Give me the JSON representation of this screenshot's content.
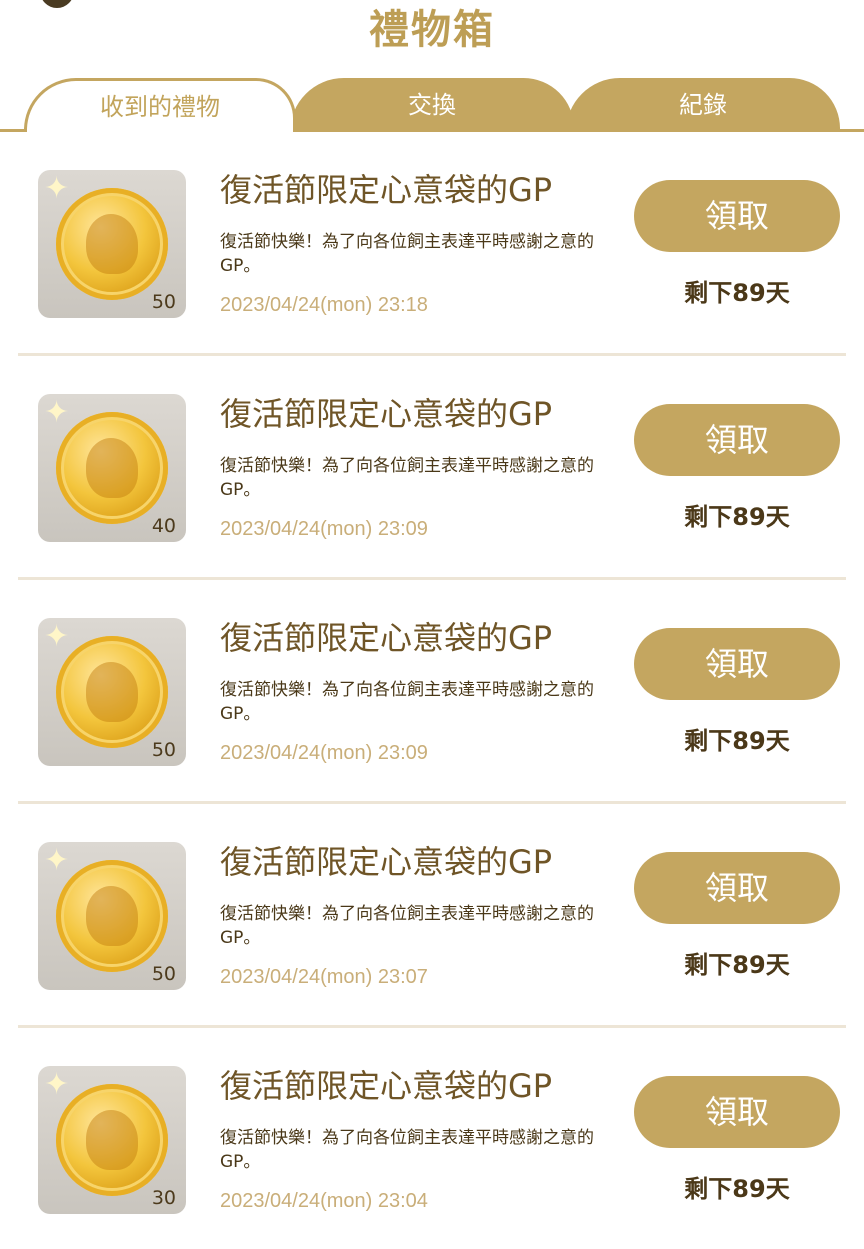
{
  "header": {
    "title": "禮物箱"
  },
  "tabs": [
    {
      "label": "收到的禮物",
      "active": true
    },
    {
      "label": "交換",
      "active": false
    },
    {
      "label": "紀錄",
      "active": false
    }
  ],
  "colors": {
    "accent": "#c4a660",
    "title": "#bd9e55",
    "date": "#c9ae79",
    "divider": "#ede5d6"
  },
  "gifts": [
    {
      "icon": "gold-coin-icon",
      "quantity": "50",
      "title": "復活節限定心意袋的GP",
      "description": "復活節快樂！為了向各位飼主表達平時感謝之意的GP。",
      "date": "2023/04/24(mon) 23:18",
      "claim_label": "領取",
      "remaining": "剩下89天"
    },
    {
      "icon": "gold-coin-icon",
      "quantity": "40",
      "title": "復活節限定心意袋的GP",
      "description": "復活節快樂！為了向各位飼主表達平時感謝之意的GP。",
      "date": "2023/04/24(mon) 23:09",
      "claim_label": "領取",
      "remaining": "剩下89天"
    },
    {
      "icon": "gold-coin-icon",
      "quantity": "50",
      "title": "復活節限定心意袋的GP",
      "description": "復活節快樂！為了向各位飼主表達平時感謝之意的GP。",
      "date": "2023/04/24(mon) 23:09",
      "claim_label": "領取",
      "remaining": "剩下89天"
    },
    {
      "icon": "gold-coin-icon",
      "quantity": "50",
      "title": "復活節限定心意袋的GP",
      "description": "復活節快樂！為了向各位飼主表達平時感謝之意的GP。",
      "date": "2023/04/24(mon) 23:07",
      "claim_label": "領取",
      "remaining": "剩下89天"
    },
    {
      "icon": "gold-coin-icon",
      "quantity": "30",
      "title": "復活節限定心意袋的GP",
      "description": "復活節快樂！為了向各位飼主表達平時感謝之意的GP。",
      "date": "2023/04/24(mon) 23:04",
      "claim_label": "領取",
      "remaining": "剩下89天"
    }
  ]
}
